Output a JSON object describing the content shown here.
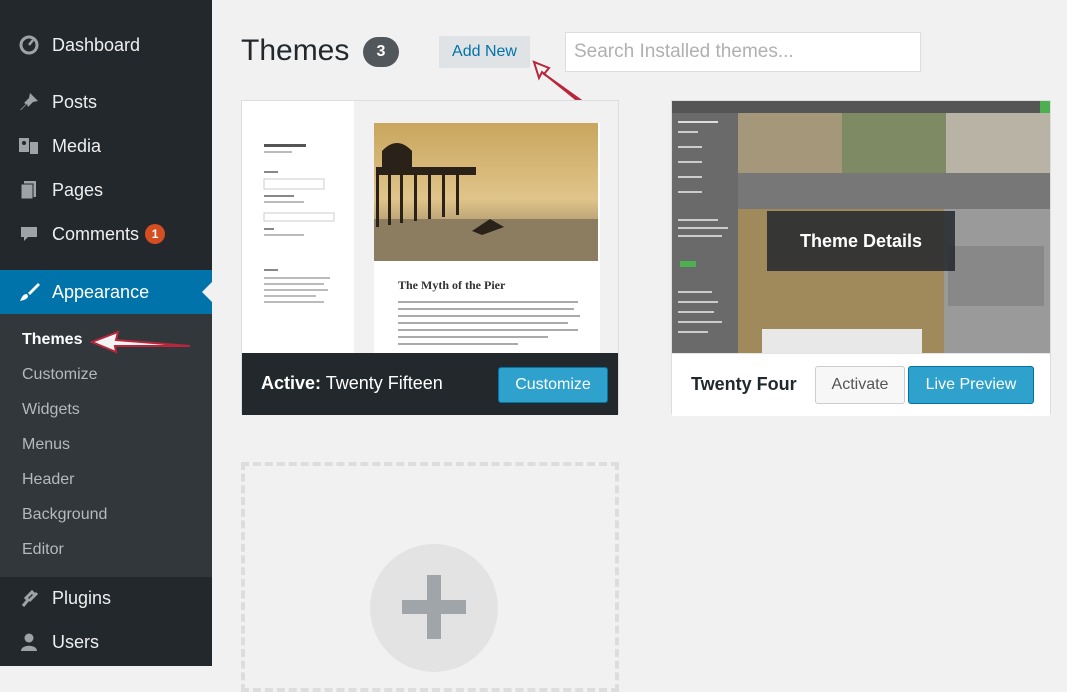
{
  "sidebar": {
    "items": [
      {
        "label": "Dashboard",
        "icon": "dashboard-icon"
      },
      {
        "label": "Posts",
        "icon": "pin-icon"
      },
      {
        "label": "Media",
        "icon": "media-icon"
      },
      {
        "label": "Pages",
        "icon": "pages-icon"
      },
      {
        "label": "Comments",
        "icon": "comment-icon",
        "badge": "1"
      },
      {
        "label": "Appearance",
        "icon": "brush-icon",
        "current": true
      },
      {
        "label": "Plugins",
        "icon": "plugin-icon"
      },
      {
        "label": "Users",
        "icon": "user-icon"
      }
    ],
    "submenu": [
      "Themes",
      "Customize",
      "Widgets",
      "Menus",
      "Header",
      "Background",
      "Editor"
    ],
    "submenu_current": "Themes"
  },
  "header": {
    "title": "Themes",
    "count": "3",
    "add_new_label": "Add New",
    "search_placeholder": "Search Installed themes..."
  },
  "themes": {
    "active": {
      "prefix": "Active:",
      "name": "Twenty Fifteen",
      "button": "Customize",
      "preview": {
        "site_title": "Twenty Fifteen",
        "post_title": "The Myth of the Pier"
      }
    },
    "other": {
      "name": "Twenty Fourteen",
      "name_visible": "Twenty Four",
      "details_label": "Theme Details",
      "activate_label": "Activate",
      "preview_label": "Live Preview"
    }
  },
  "colors": {
    "sidebar": "#23282d",
    "submenu": "#32373c",
    "accent": "#0073aa",
    "button_blue": "#2ea2cc",
    "badge": "#d54e21"
  }
}
